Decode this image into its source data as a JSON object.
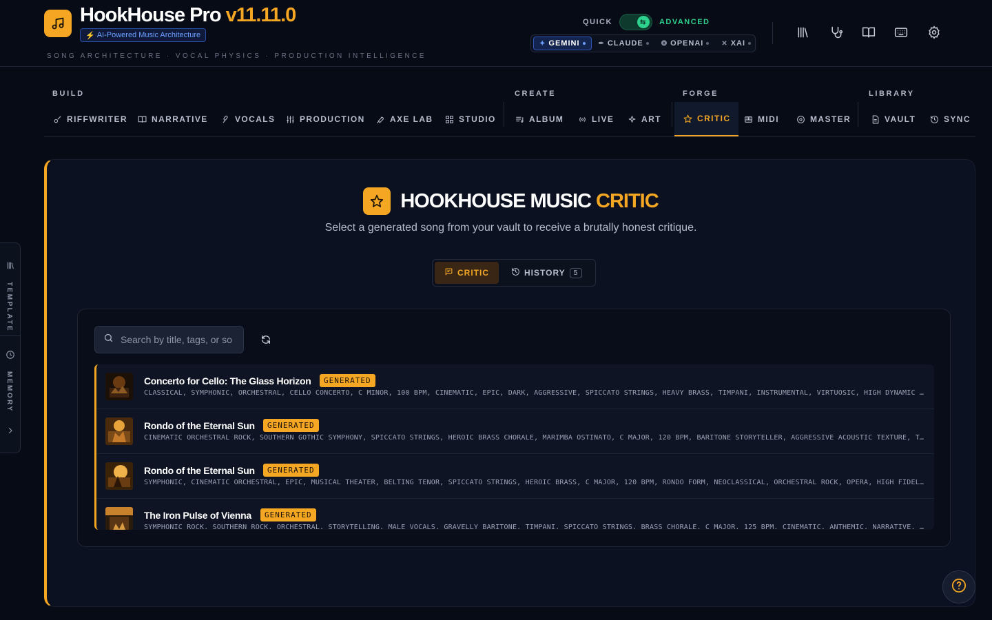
{
  "header": {
    "app_name": "HookHouse Pro",
    "version": "v11.11.0",
    "badge": "AI-Powered Music Architecture",
    "tagline": "SONG ARCHITECTURE · VOCAL PHYSICS · PRODUCTION INTELLIGENCE",
    "mode": {
      "left": "QUICK",
      "right": "ADVANCED",
      "state": "advanced"
    },
    "providers": [
      {
        "label": "GEMINI",
        "icon": "sparkle-icon",
        "active": true
      },
      {
        "label": "CLAUDE",
        "icon": "feather-icon",
        "active": false
      },
      {
        "label": "OPENAI",
        "icon": "openai-icon",
        "active": false
      },
      {
        "label": "XAI",
        "icon": "x-icon",
        "active": false
      }
    ],
    "icons": [
      "library-icon",
      "stethoscope-icon",
      "book-icon",
      "keyboard-icon",
      "gear-icon"
    ]
  },
  "nav": {
    "groups": {
      "build": "BUILD",
      "create": "CREATE",
      "forge": "FORGE",
      "library": "LIBRARY"
    },
    "items": [
      {
        "label": "RIFFWRITER",
        "icon": "guitar-icon"
      },
      {
        "label": "NARRATIVE",
        "icon": "book-open-icon"
      },
      {
        "label": "VOCALS",
        "icon": "mic-icon"
      },
      {
        "label": "PRODUCTION",
        "icon": "sliders-icon"
      },
      {
        "label": "AXE LAB",
        "icon": "wrench-icon"
      },
      {
        "label": "STUDIO",
        "icon": "grid-icon"
      },
      {
        "label": "ALBUM",
        "icon": "list-music-icon"
      },
      {
        "label": "LIVE",
        "icon": "radio-icon"
      },
      {
        "label": "ART",
        "icon": "sparkles-icon"
      },
      {
        "label": "CRITIC",
        "icon": "star-icon",
        "active": true
      },
      {
        "label": "MIDI",
        "icon": "piano-icon"
      },
      {
        "label": "MASTER",
        "icon": "disc-icon"
      },
      {
        "label": "VAULT",
        "icon": "file-icon"
      },
      {
        "label": "SYNC",
        "icon": "history-icon"
      }
    ]
  },
  "sidebar": {
    "template": "TEMPLATE",
    "memory": "MEMORY"
  },
  "critic": {
    "title_main": "HOOKHOUSE MUSIC",
    "title_accent": "CRITIC",
    "subtitle": "Select a generated song from your vault to receive a brutally honest critique.",
    "tabs": {
      "critic": "CRITIC",
      "history": "HISTORY",
      "history_count": "5"
    },
    "search_placeholder": "Search by title, tags, or so",
    "songs": [
      {
        "title": "Concerto for Cello: The Glass Horizon",
        "badge": "GENERATED",
        "tags": "CLASSICAL, SYMPHONIC, ORCHESTRAL, CELLO CONCERTO, C MINOR, 100 BPM, CINEMATIC, EPIC, DARK, AGGRESSIVE, SPICCATO STRINGS, HEAVY BRASS, TIMPANI, INSTRUMENTAL, VIRTUOSIC, HIGH DYNAMIC RANGE, FULL ORCHESTRA"
      },
      {
        "title": "Rondo of the Eternal Sun",
        "badge": "GENERATED",
        "tags": "CINEMATIC ORCHESTRAL ROCK, SOUTHERN GOTHIC SYMPHONY, SPICCATO STRINGS, HEROIC BRASS CHORALE, MARIMBA OSTINATO, C MAJOR, 120 BPM, BARITONE STORYTELLER, AGGRESSIVE ACOUSTIC TEXTURE, TIMPANI ROLLS"
      },
      {
        "title": "Rondo of the Eternal Sun",
        "badge": "GENERATED",
        "tags": "SYMPHONIC, CINEMATIC ORCHESTRAL, EPIC, MUSICAL THEATER, BELTING TENOR, SPICCATO STRINGS, HEROIC BRASS, C MAJOR, 120 BPM, RONDO FORM, NEOCLASSICAL, ORCHESTRAL ROCK, OPERA, HIGH FIDELITY, WIDE STEREO"
      },
      {
        "title": "The Iron Pulse of Vienna",
        "badge": "GENERATED",
        "tags": "SYMPHONIC ROCK. SOUTHERN ROCK. ORCHESTRAL. STORYTELLING. MALE VOCALS. GRAVELLY BARITONE. TIMPANI. SPICCATO STRINGS. BRASS CHORALE. C MAJOR. 125 BPM. CINEMATIC. ANTHEMIC. NARRATIVE. CRESCENDO"
      }
    ]
  },
  "colors": {
    "accent": "#f5a623",
    "background": "#070b16",
    "panel": "#0b1120",
    "advanced": "#2fd18e",
    "provider": "#6ea0ff"
  }
}
